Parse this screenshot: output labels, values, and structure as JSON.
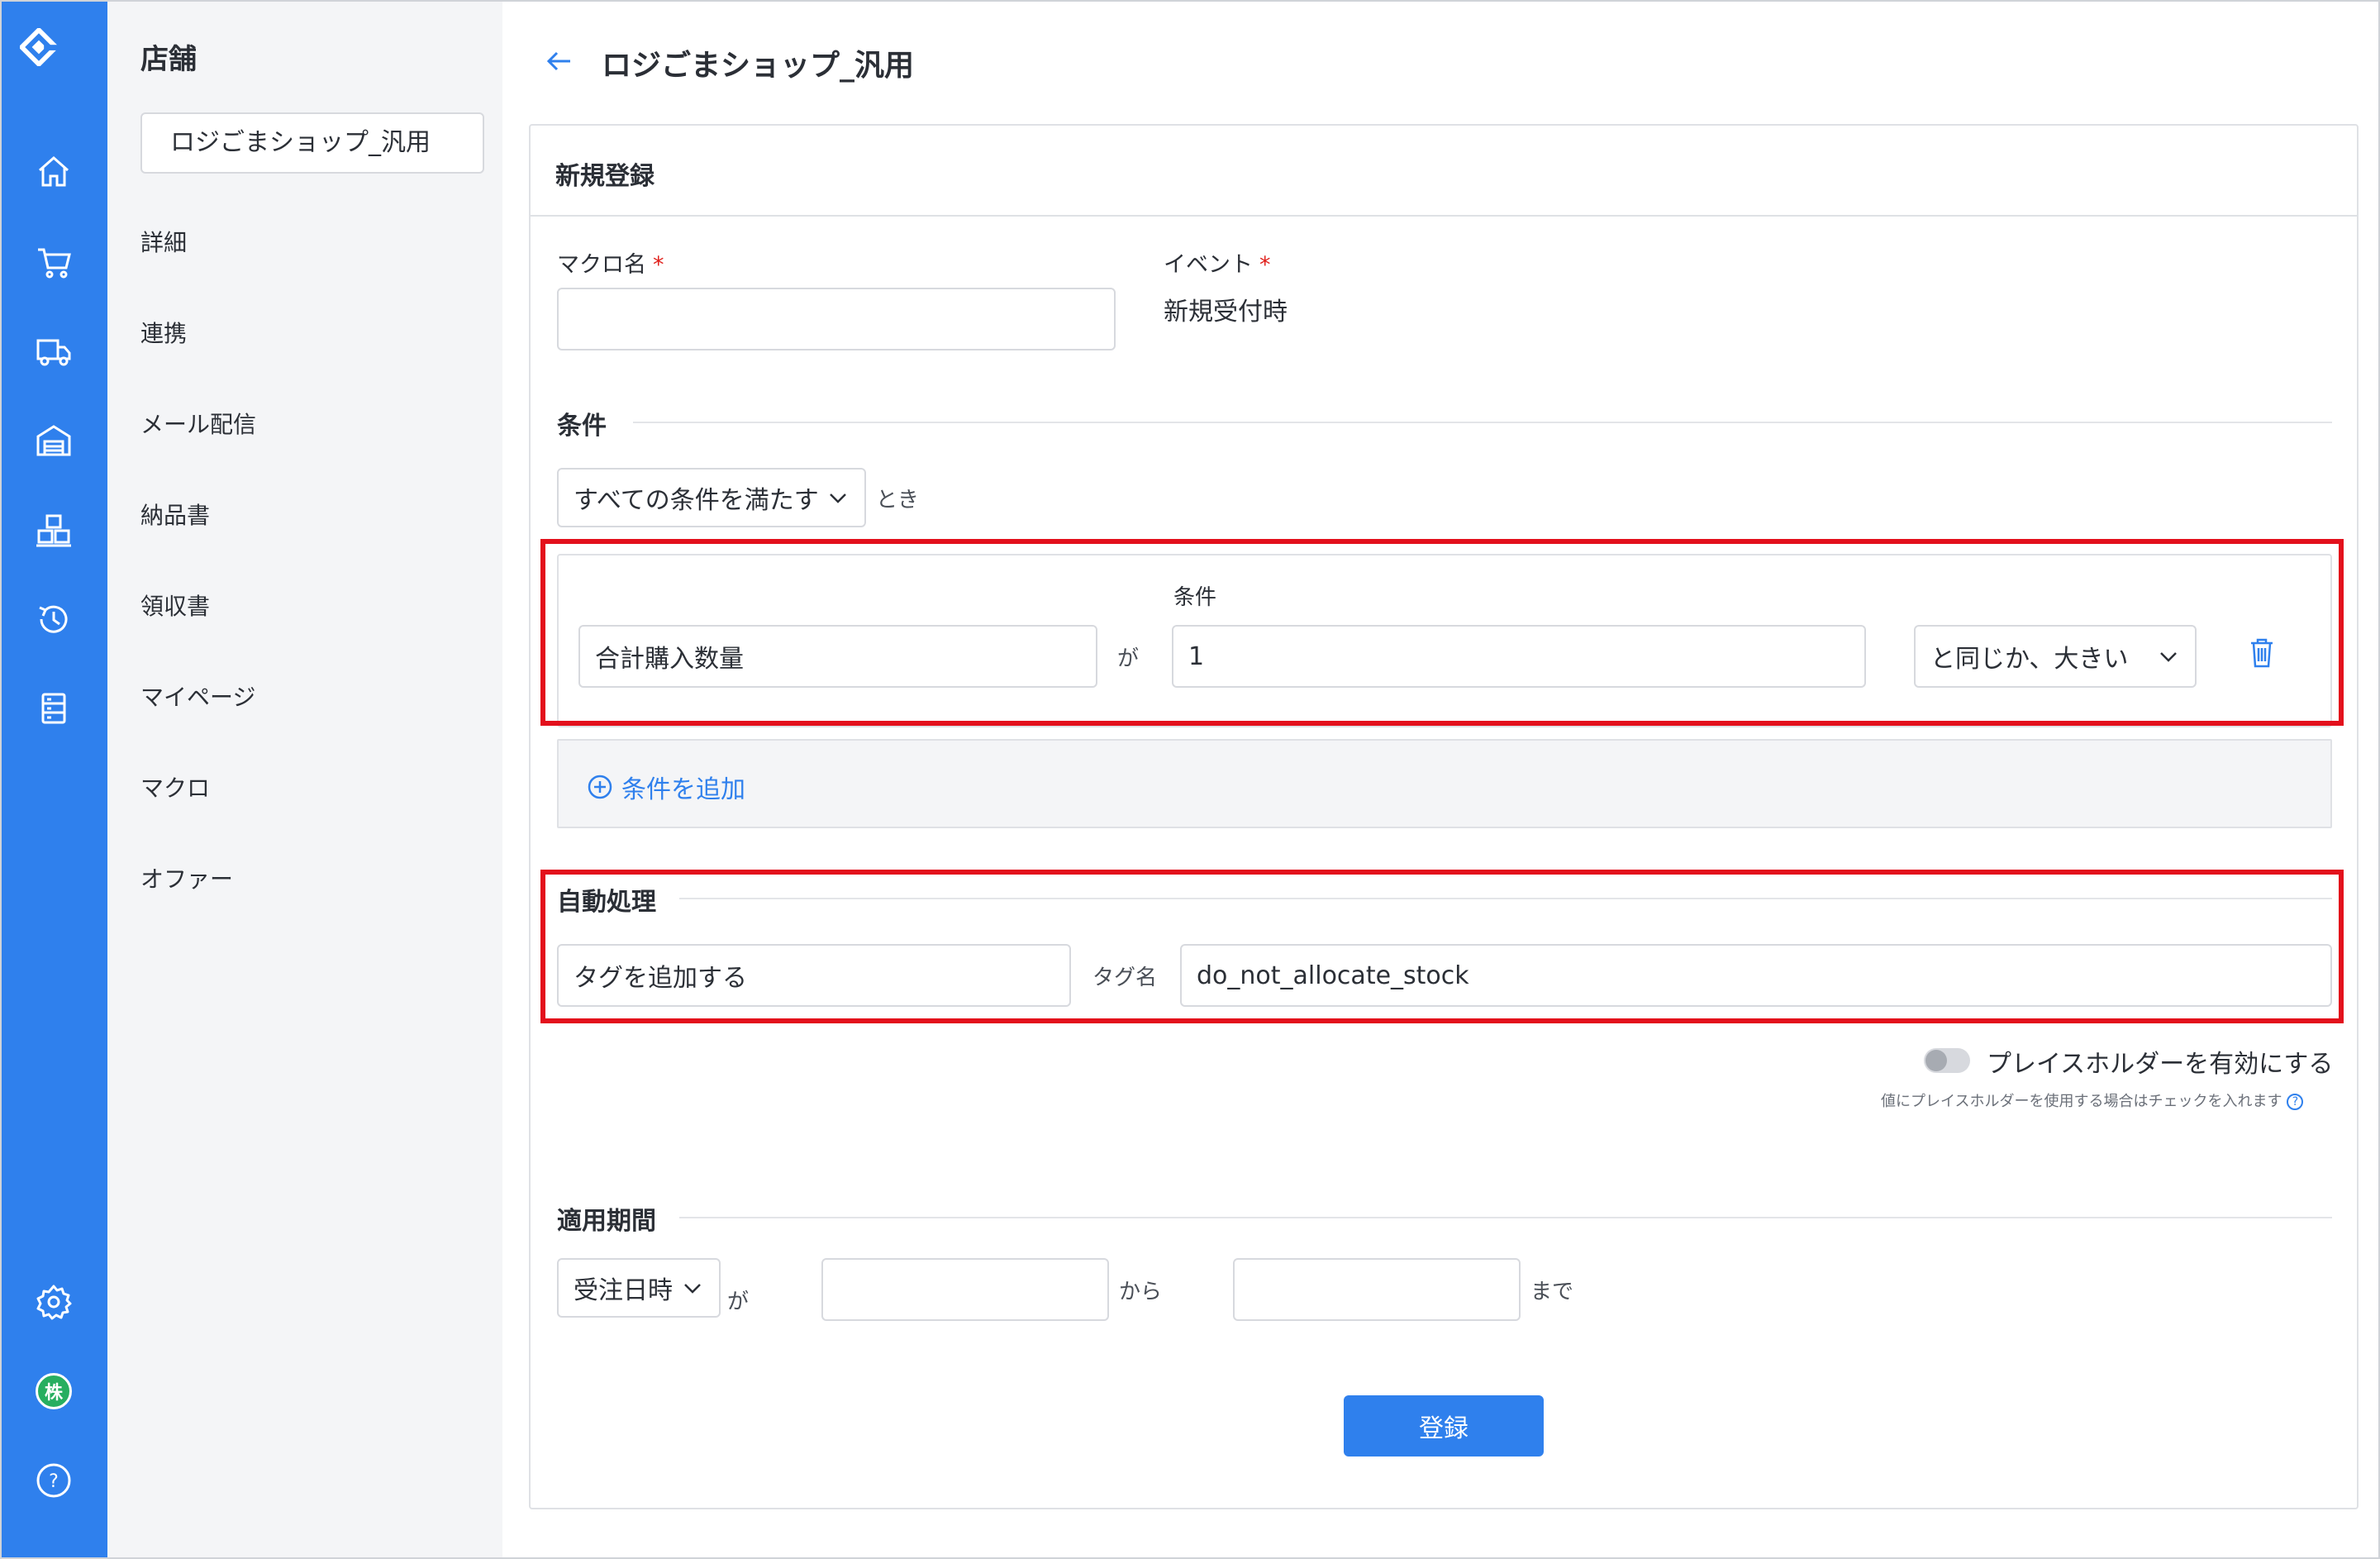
{
  "rail": {
    "icons": [
      "logo-icon",
      "home-icon",
      "cart-icon",
      "truck-icon",
      "warehouse-icon",
      "boxes-icon",
      "history-icon",
      "list-icon",
      "gear-icon",
      "company-badge",
      "help-icon"
    ],
    "company_badge": "株",
    "help_glyph": "?"
  },
  "sidebar": {
    "title": "店舗",
    "store_name": "ロジごまショップ_汎用",
    "items": [
      {
        "label": "詳細"
      },
      {
        "label": "連携"
      },
      {
        "label": "メール配信"
      },
      {
        "label": "納品書"
      },
      {
        "label": "領収書"
      },
      {
        "label": "マイページ"
      },
      {
        "label": "マクロ"
      },
      {
        "label": "オファー"
      }
    ]
  },
  "page": {
    "title": "ロジごまショップ_汎用"
  },
  "form": {
    "header": "新規登録",
    "macro_name_label": "マクロ名",
    "macro_name_value": "",
    "event_label": "イベント",
    "event_value": "新規受付時",
    "required_mark": "*",
    "conditions": {
      "section_title": "条件",
      "match_select": "すべての条件を満たす",
      "match_suffix": "とき",
      "row": {
        "field": "合計購入数量",
        "particle": "が",
        "value_label": "条件",
        "value": "1",
        "operator": "と同じか、大きい"
      },
      "add_label": "条件を追加"
    },
    "auto": {
      "section_title": "自動処理",
      "action": "タグを追加する",
      "tag_label": "タグ名",
      "tag_value": "do_not_allocate_stock",
      "placeholder_toggle_label": "プレイスホルダーを有効にする",
      "placeholder_hint": "値にプレイスホルダーを使用する場合はチェックを入れます",
      "toggle_on": false
    },
    "period": {
      "section_title": "適用期間",
      "basis_select": "受注日時",
      "particle": "が",
      "from_value": "",
      "from_suffix": "から",
      "to_value": "",
      "to_suffix": "まで"
    },
    "submit_label": "登録"
  },
  "colors": {
    "rail": "#2f80ed",
    "accent": "#2f80ed",
    "highlight": "#e3101c",
    "required": "#e0201b",
    "badge": "#27ae60"
  }
}
